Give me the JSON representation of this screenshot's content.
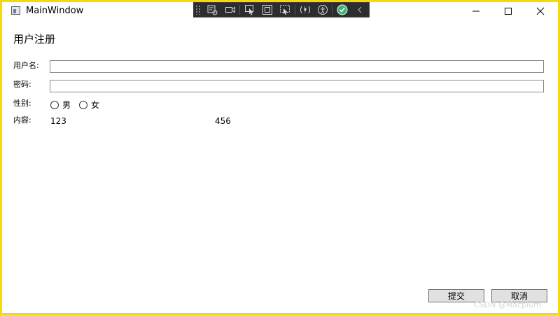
{
  "window": {
    "title": "MainWindow",
    "border_color": "#f5d90a",
    "background": "#ffffff"
  },
  "toolbar": {
    "items": [
      {
        "icon": "select-element-icon"
      },
      {
        "icon": "video-camera-icon"
      },
      {
        "icon": "pointer-select-icon"
      },
      {
        "icon": "display-layout-adorners-icon"
      },
      {
        "icon": "track-focused-element-icon"
      },
      {
        "icon": "hot-reload-icon"
      },
      {
        "icon": "accessibility-icon"
      },
      {
        "icon": "check-circle-icon",
        "color": "#3cb371"
      },
      {
        "icon": "collapse-chevron-icon"
      }
    ]
  },
  "form": {
    "heading": "用户注册",
    "username_label": "用户名:",
    "username_value": "",
    "password_label": "密码:",
    "password_value": "",
    "gender_label": "性别:",
    "gender_options": [
      "男",
      "女"
    ],
    "content_label": "内容:",
    "content_values": [
      "123",
      "456"
    ]
  },
  "buttons": {
    "submit": "提交",
    "cancel": "取消"
  },
  "watermark": "CSDN @Macplum"
}
